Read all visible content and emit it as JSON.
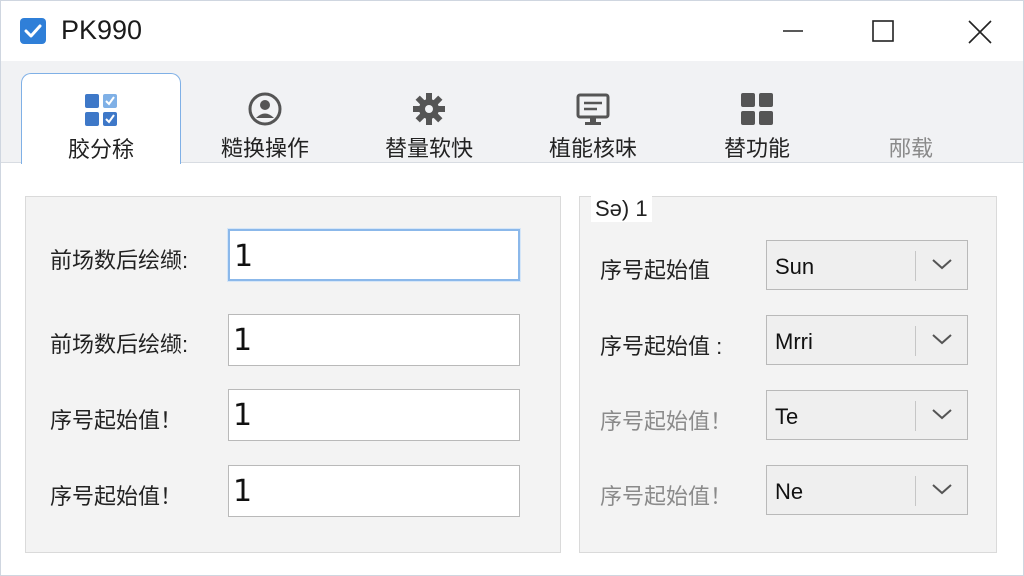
{
  "window": {
    "title": "PK990",
    "controls": [
      "minimize-icon",
      "maximize-icon",
      "close-icon"
    ]
  },
  "tabs": [
    {
      "label": "㬵分稌",
      "icon": "app-grid-check-icon",
      "active": true
    },
    {
      "label": "糙换操作",
      "icon": "user-circle-icon",
      "active": false
    },
    {
      "label": "替量软快",
      "icon": "gear-icon",
      "active": false
    },
    {
      "label": "植能核味",
      "icon": "monitor-icon",
      "active": false
    },
    {
      "label": "替功能",
      "icon": "grid-icon",
      "active": false
    },
    {
      "label": "邴载",
      "icon": "",
      "active": false
    }
  ],
  "left_panel": {
    "rows": [
      {
        "label": "前场数后绘缬:",
        "value": "1"
      },
      {
        "label": "前场数后绘缬:",
        "value": "1"
      },
      {
        "label": "序号起始值！",
        "value": "1"
      },
      {
        "label": "序号起始值！",
        "value": "1"
      }
    ]
  },
  "right_panel": {
    "title": "Sə) 1",
    "rows": [
      {
        "label": "序号起始值",
        "value": "Sun"
      },
      {
        "label": "序号起始值 :",
        "value": "Mrri"
      },
      {
        "label": "序号起始值！",
        "value": "Te"
      },
      {
        "label": "序号起始值！",
        "value": "Ne"
      }
    ]
  },
  "colors": {
    "accent": "#2f7fd8",
    "tab_border": "#7fb0e6",
    "panel_bg": "#f3f3f3",
    "dim_text": "#8a8a8a"
  }
}
